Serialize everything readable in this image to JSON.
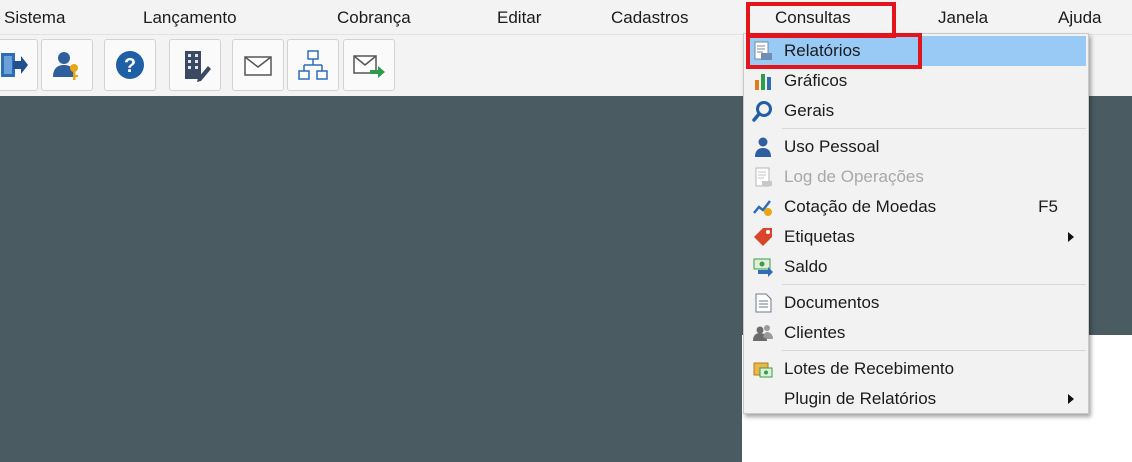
{
  "menubar": {
    "items": [
      "Sistema",
      "Lançamento",
      "Cobrança",
      "Editar",
      "Cadastros",
      "Consultas",
      "Janela",
      "Ajuda"
    ]
  },
  "toolbar": {
    "buttons": [
      "exit-icon",
      "user-key-icon",
      "help-icon",
      "building-edit-icon",
      "envelope-icon",
      "org-chart-icon",
      "send-mail-icon"
    ]
  },
  "dropdown": {
    "items": [
      {
        "label": "Relatórios",
        "icon": "report-icon"
      },
      {
        "label": "Gráficos",
        "icon": "bar-chart-icon"
      },
      {
        "label": "Gerais",
        "icon": "magnifier-icon"
      },
      {
        "label": "Uso Pessoal",
        "icon": "person-icon"
      },
      {
        "label": "Log de Operações",
        "icon": "log-document-icon",
        "disabled": true
      },
      {
        "label": "Cotação de Moedas",
        "icon": "currency-chart-icon",
        "shortcut": "F5"
      },
      {
        "label": "Etiquetas",
        "icon": "tag-icon",
        "submenu": true
      },
      {
        "label": "Saldo",
        "icon": "balance-icon"
      },
      {
        "label": "Documentos",
        "icon": "document-icon"
      },
      {
        "label": "Clientes",
        "icon": "clients-icon"
      },
      {
        "label": "Lotes de Recebimento",
        "icon": "receipt-batch-icon"
      },
      {
        "label": "Plugin de Relatórios",
        "icon": "",
        "submenu": true
      }
    ]
  },
  "colors": {
    "highlight_border": "#e3141c",
    "selected_bg": "#99c9f5",
    "workspace_bg": "#4b5b62"
  }
}
